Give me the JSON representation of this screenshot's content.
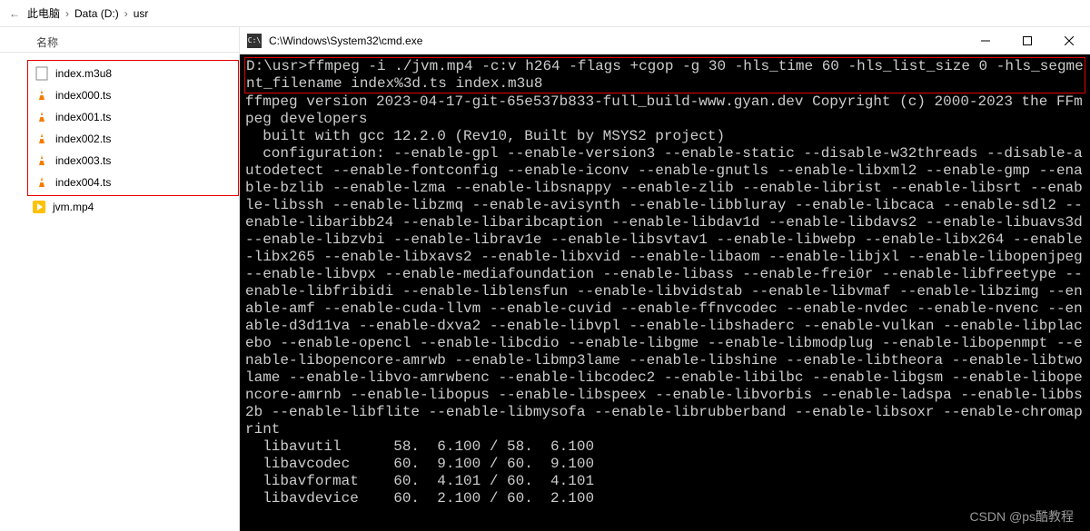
{
  "breadcrumb": {
    "back_symbol": "←",
    "items": [
      "此电脑",
      "Data (D:)",
      "usr"
    ],
    "sep": "›"
  },
  "explorer": {
    "column_header": "名称",
    "highlighted_files": [
      {
        "name": "index.m3u8",
        "icon": "file"
      },
      {
        "name": "index000.ts",
        "icon": "vlc"
      },
      {
        "name": "index001.ts",
        "icon": "vlc"
      },
      {
        "name": "index002.ts",
        "icon": "vlc"
      },
      {
        "name": "index003.ts",
        "icon": "vlc"
      },
      {
        "name": "index004.ts",
        "icon": "vlc"
      }
    ],
    "other_files": [
      {
        "name": "jvm.mp4",
        "icon": "media"
      }
    ]
  },
  "cmd_window": {
    "title": "C:\\Windows\\System32\\cmd.exe",
    "icon_text": "C:\\",
    "prompt_line": "D:\\usr>ffmpeg -i ./jvm.mp4 -c:v h264 -flags +cgop -g 30 -hls_time 60 -hls_list_size 0 -hls_segment_filename index%3d.ts index.m3u8",
    "output": "ffmpeg version 2023-04-17-git-65e537b833-full_build-www.gyan.dev Copyright (c) 2000-2023 the FFmpeg developers\n  built with gcc 12.2.0 (Rev10, Built by MSYS2 project)\n  configuration: --enable-gpl --enable-version3 --enable-static --disable-w32threads --disable-autodetect --enable-fontconfig --enable-iconv --enable-gnutls --enable-libxml2 --enable-gmp --enable-bzlib --enable-lzma --enable-libsnappy --enable-zlib --enable-librist --enable-libsrt --enable-libssh --enable-libzmq --enable-avisynth --enable-libbluray --enable-libcaca --enable-sdl2 --enable-libaribb24 --enable-libaribcaption --enable-libdav1d --enable-libdavs2 --enable-libuavs3d --enable-libzvbi --enable-librav1e --enable-libsvtav1 --enable-libwebp --enable-libx264 --enable-libx265 --enable-libxavs2 --enable-libxvid --enable-libaom --enable-libjxl --enable-libopenjpeg --enable-libvpx --enable-mediafoundation --enable-libass --enable-frei0r --enable-libfreetype --enable-libfribidi --enable-liblensfun --enable-libvidstab --enable-libvmaf --enable-libzimg --enable-amf --enable-cuda-llvm --enable-cuvid --enable-ffnvcodec --enable-nvdec --enable-nvenc --enable-d3d11va --enable-dxva2 --enable-libvpl --enable-libshaderc --enable-vulkan --enable-libplacebo --enable-opencl --enable-libcdio --enable-libgme --enable-libmodplug --enable-libopenmpt --enable-libopencore-amrwb --enable-libmp3lame --enable-libshine --enable-libtheora --enable-libtwolame --enable-libvo-amrwbenc --enable-libcodec2 --enable-libilbc --enable-libgsm --enable-libopencore-amrnb --enable-libopus --enable-libspeex --enable-libvorbis --enable-ladspa --enable-libbs2b --enable-libflite --enable-libmysofa --enable-librubberband --enable-libsoxr --enable-chromaprint\n  libavutil      58.  6.100 / 58.  6.100\n  libavcodec     60.  9.100 / 60.  9.100\n  libavformat    60.  4.101 / 60.  4.101\n  libavdevice    60.  2.100 / 60.  2.100"
  },
  "watermark": "CSDN @ps酷教程"
}
